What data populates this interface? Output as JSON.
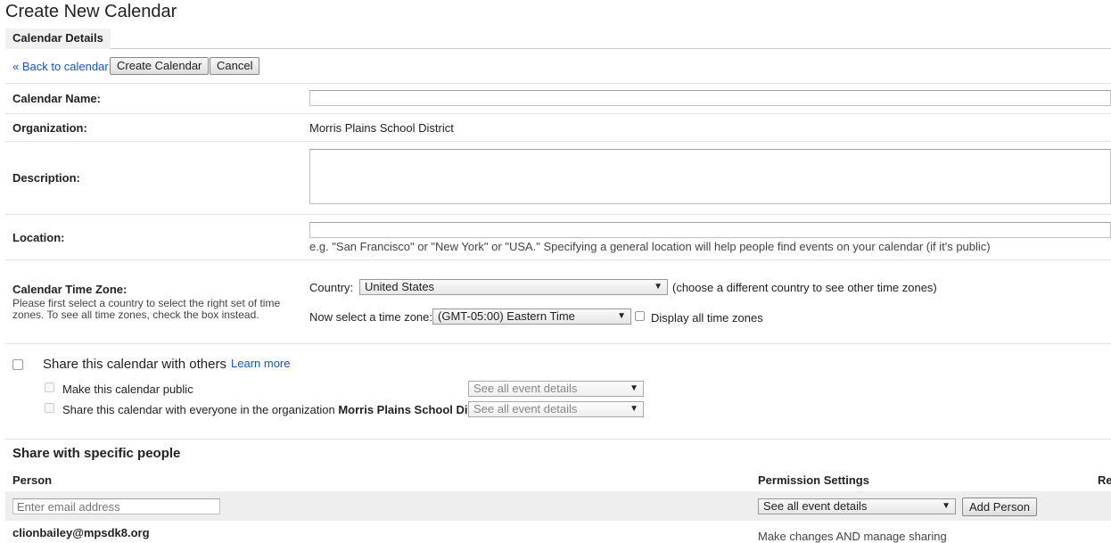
{
  "page": {
    "title": "Create New Calendar"
  },
  "tabs": [
    {
      "label": "Calendar Details"
    }
  ],
  "actions": {
    "back_link": "« Back to calendar",
    "create_button": "Create Calendar",
    "cancel_button": "Cancel"
  },
  "form": {
    "name_label": "Calendar Name:",
    "name_value": "",
    "organization_label": "Organization:",
    "organization_value": "Morris Plains School District",
    "description_label": "Description:",
    "description_value": "",
    "location_label": "Location:",
    "location_value": "",
    "location_hint": "e.g. \"San Francisco\" or \"New York\" or \"USA.\" Specifying a general location will help people find events on your calendar (if it's public)",
    "timezone_label": "Calendar Time Zone:",
    "timezone_help_line1": "Please first select a country to select the right set of time",
    "timezone_help_line2": "zones. To see all time zones, check the box instead.",
    "country_label": "Country:",
    "country_value": "United States",
    "country_hint": "(choose a different country to see other time zones)",
    "tz_label": "Now select a time zone:",
    "tz_value": "(GMT-05:00) Eastern Time",
    "display_all_label": "Display all time zones"
  },
  "sharing": {
    "share_label": "Share this calendar with others",
    "learn_more": "Learn more",
    "public_label": "Make this calendar public",
    "public_select": "See all event details",
    "org_label_prefix": "Share this calendar with everyone in the organization",
    "org_name": "Morris Plains School District",
    "org_select": "See all event details"
  },
  "specific": {
    "heading": "Share with specific people",
    "col_person": "Person",
    "col_permission": "Permission Settings",
    "col_remove": "Re",
    "email_placeholder": "Enter email address",
    "permission_value": "See all event details",
    "add_button": "Add Person",
    "row_email": "clionbailey@mpsdk8.org",
    "row_permission": "Make changes AND manage sharing"
  }
}
